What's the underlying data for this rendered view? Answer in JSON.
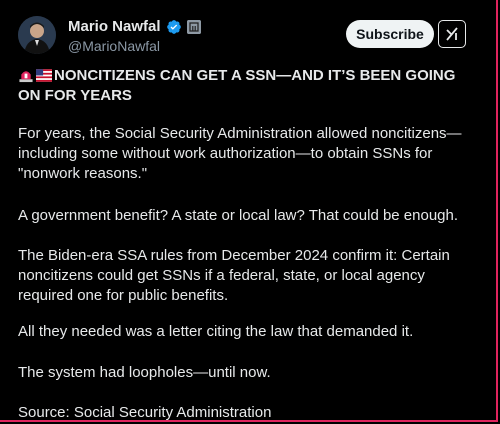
{
  "author": {
    "name": "Mario Nawfal",
    "handle": "@MarioNawfal",
    "verified_color": "#1d9bf0"
  },
  "actions": {
    "subscribe_label": "Subscribe",
    "grok_icon": "grok-icon"
  },
  "post": {
    "headline_emojis": [
      "siren-emoji",
      "us-flag-emoji"
    ],
    "headline": "NONCITIZENS CAN GET A SSN—AND IT’S BEEN GOING ON FOR YEARS",
    "paragraphs": [
      "For years, the Social Security Administration allowed noncitizens—including some without work authorization—to obtain SSNs for \"nonwork reasons.\"",
      "A government benefit? A state or local law? That could be enough.",
      "The Biden-era SSA rules from December 2024 confirm it: Certain noncitizens could get SSNs if a federal, state, or local agency required one for public benefits.",
      "All they needed was a letter citing the law that demanded it.",
      "The system had loopholes—until now.",
      "Source: Social Security Administration"
    ]
  },
  "colors": {
    "background": "#000000",
    "text": "#e7e9ea",
    "muted": "#8b98a5",
    "border_accent": "#e0245e"
  }
}
